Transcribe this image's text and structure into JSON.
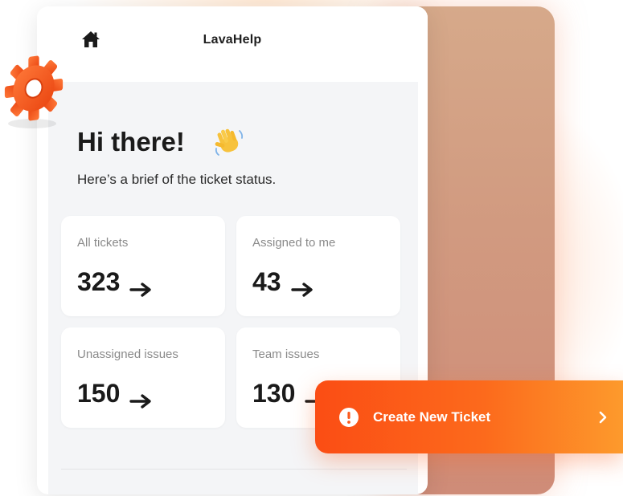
{
  "header": {
    "app_name": "LavaHelp",
    "home_icon": "home-icon"
  },
  "greeting": {
    "title": "Hi there!",
    "emoji": "waving-hand",
    "subtitle": "Here’s a brief of the ticket status."
  },
  "stats": [
    {
      "label": "All tickets",
      "value": "323"
    },
    {
      "label": "Assigned to me",
      "value": "43"
    },
    {
      "label": "Unassigned issues",
      "value": "150"
    },
    {
      "label": "Team issues",
      "value": "130"
    }
  ],
  "cta": {
    "label": "Create New Ticket",
    "icon": "alert-circle-icon",
    "chevron": "chevron-right-icon"
  },
  "decor": {
    "gear_icon": "gear-icon"
  },
  "colors": {
    "accent_start": "#fb4d14",
    "accent_end": "#fd9a2c",
    "gear": "#fb5a1e",
    "card_bg": "#ffffff",
    "content_bg": "#f4f5f7"
  }
}
